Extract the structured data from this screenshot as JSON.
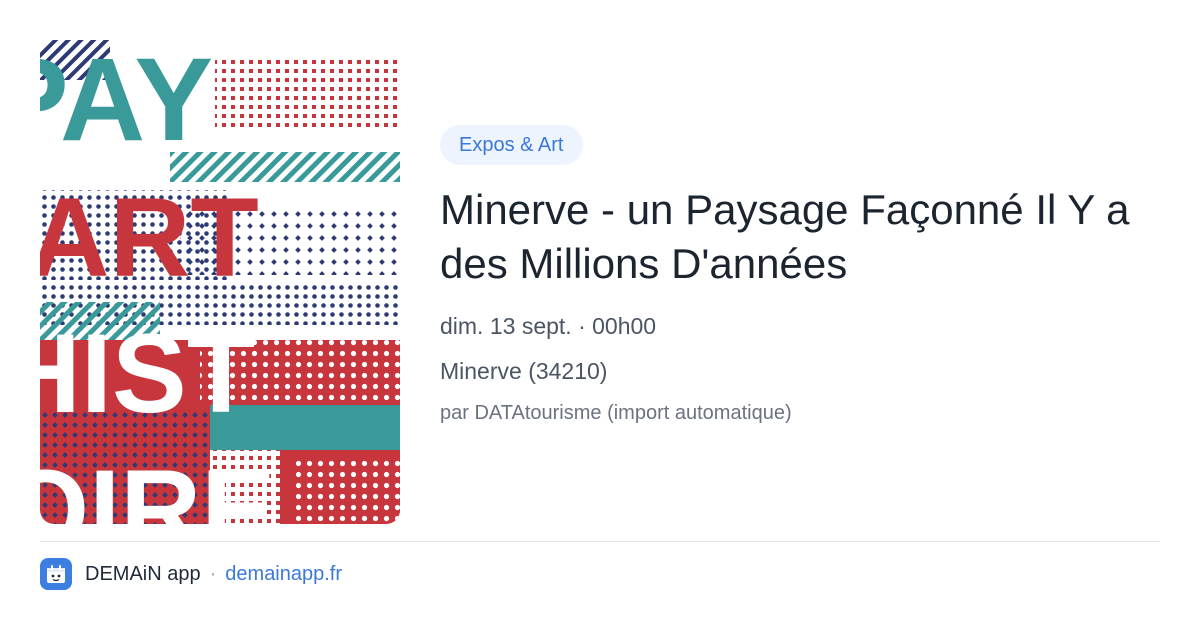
{
  "card": {
    "category": "Expos & Art",
    "title": "Minerve - un Paysage Façonné Il Y a des Millions D'années",
    "datetime": "dim. 13 sept. · 00h00",
    "location": "Minerve (34210)",
    "source": "par DATAtourisme (import automatique)"
  },
  "poster": {
    "lines": [
      "PAY",
      "'ART",
      "HIST",
      "OIRE"
    ],
    "colors": {
      "teal": "#3a9a9a",
      "red": "#c7363c",
      "navy": "#2d3a73"
    }
  },
  "footer": {
    "app_icon": "demain-app-icon",
    "app_name": "DEMAiN app",
    "separator": "·",
    "domain": "demainapp.fr"
  },
  "colors": {
    "badge_bg": "#eef4fd",
    "accent": "#3b78d8",
    "title": "#1c2430",
    "muted": "#6b7280"
  }
}
